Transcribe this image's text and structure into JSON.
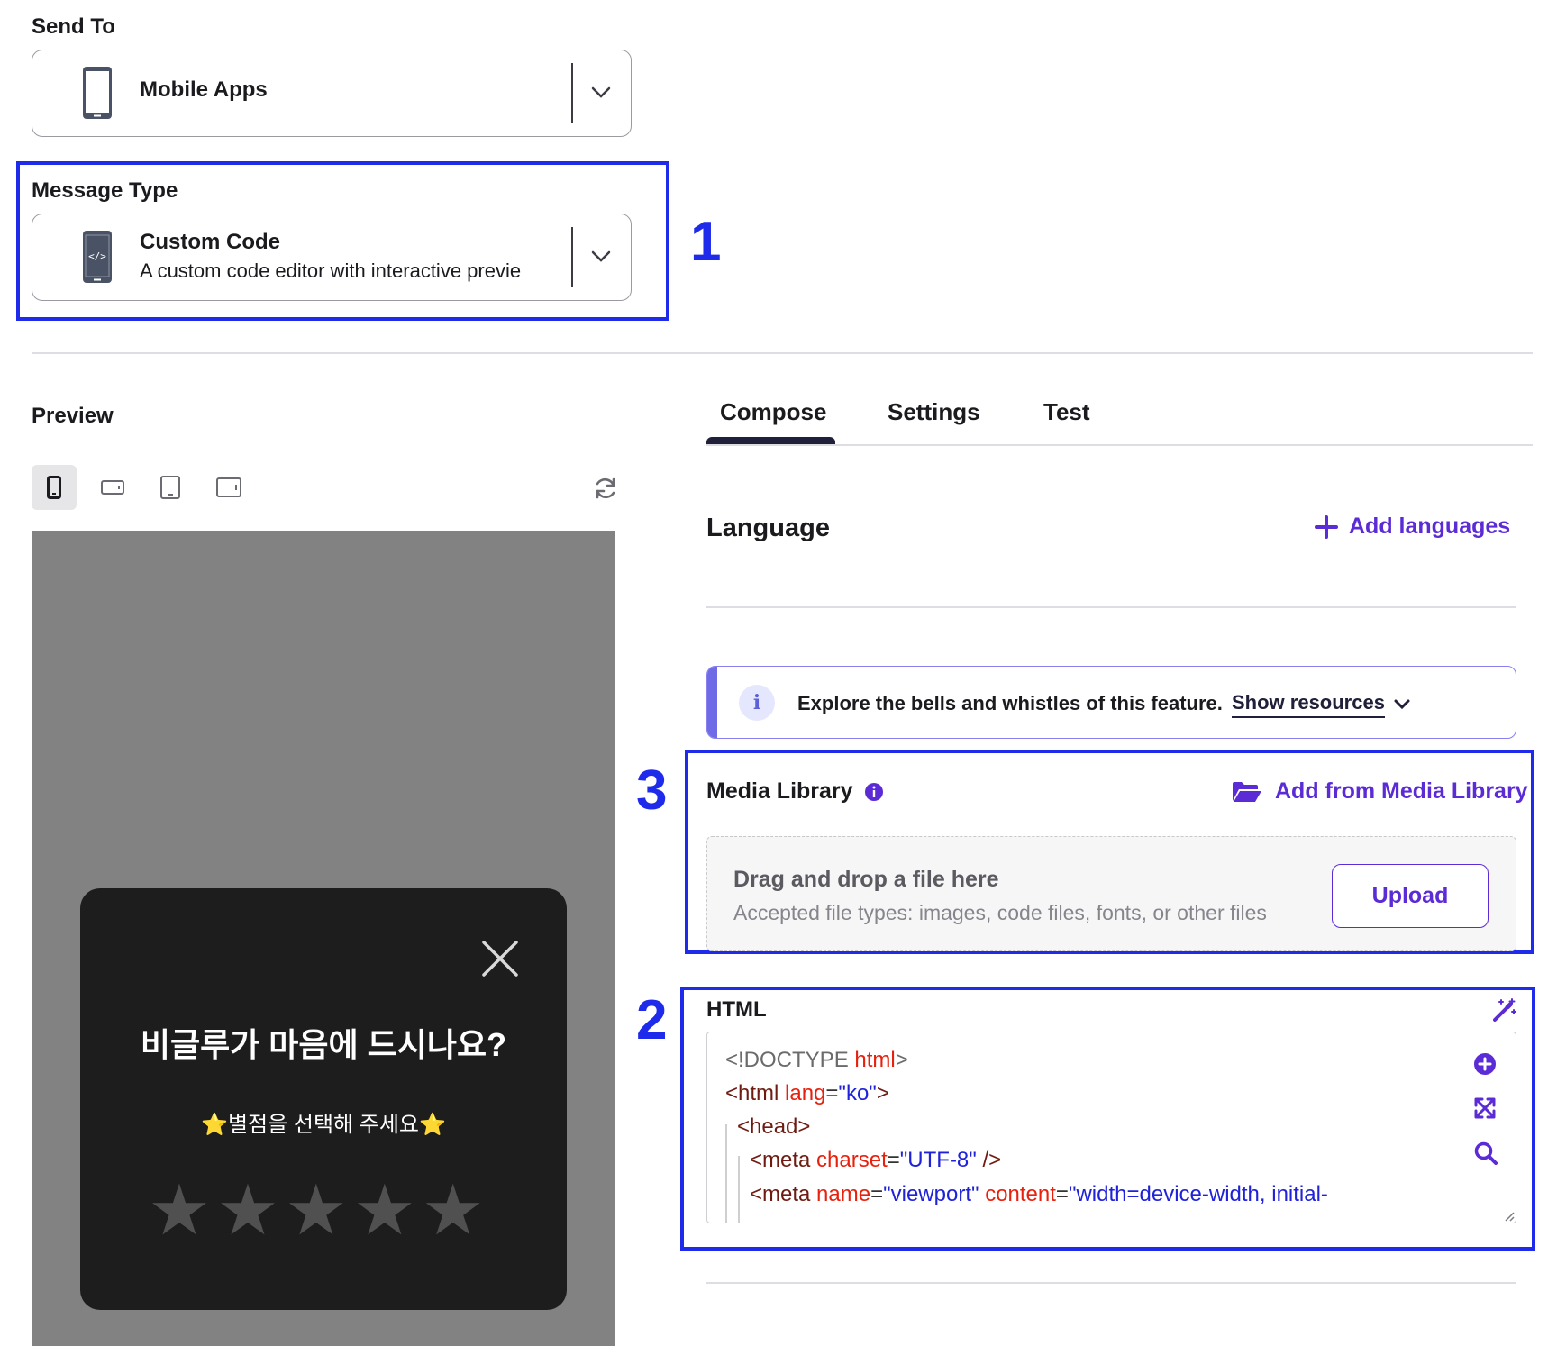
{
  "send_to": {
    "label": "Send To",
    "value": "Mobile Apps"
  },
  "message_type": {
    "label": "Message Type",
    "value": "Custom Code",
    "description": "A custom code editor with interactive previe"
  },
  "annotations": [
    "1",
    "2",
    "3"
  ],
  "preview": {
    "title": "Preview",
    "devices": [
      "phone-portrait-icon",
      "phone-landscape-icon",
      "tablet-portrait-icon",
      "tablet-landscape-icon"
    ],
    "modal": {
      "title": "비글루가 마음에 드시나요?",
      "subtitle": "⭐별점을 선택해 주세요⭐",
      "stars": [
        "★",
        "★",
        "★",
        "★",
        "★"
      ]
    }
  },
  "tabs": [
    {
      "label": "Compose",
      "active": true
    },
    {
      "label": "Settings",
      "active": false
    },
    {
      "label": "Test",
      "active": false
    }
  ],
  "language": {
    "title": "Language",
    "add_label": "Add languages"
  },
  "banner": {
    "text": "Explore the bells and whistles of this feature.",
    "link": "Show resources"
  },
  "media_library": {
    "title": "Media Library",
    "add_label": "Add from Media Library",
    "drop_title": "Drag and drop a file here",
    "drop_sub": "Accepted file types: images, code files, fonts, or other files",
    "upload_label": "Upload"
  },
  "html_editor": {
    "label": "HTML",
    "lines": {
      "l1_a": "<!DOCTYPE ",
      "l1_b": "html",
      "l1_c": ">",
      "l2_a": "<html ",
      "l2_b": "lang",
      "l2_c": "=",
      "l2_d": "\"ko\"",
      "l2_e": ">",
      "l3_a": "<head>",
      "l4_a": "<meta ",
      "l4_b": "charset",
      "l4_c": "=",
      "l4_d": "\"UTF-8\"",
      "l4_e": " />",
      "l5_a": "<meta ",
      "l5_b": "name",
      "l5_c": "=",
      "l5_d": "\"viewport\"",
      "l5_e": " ",
      "l5_f": "content",
      "l5_g": "=",
      "l5_h": "\"width=device-width, initial-"
    }
  },
  "colors": {
    "accent": "#5b2bd6",
    "annotation": "#1f2bea",
    "modal_bg": "#1d1d1d",
    "preview_bg": "#828282"
  }
}
